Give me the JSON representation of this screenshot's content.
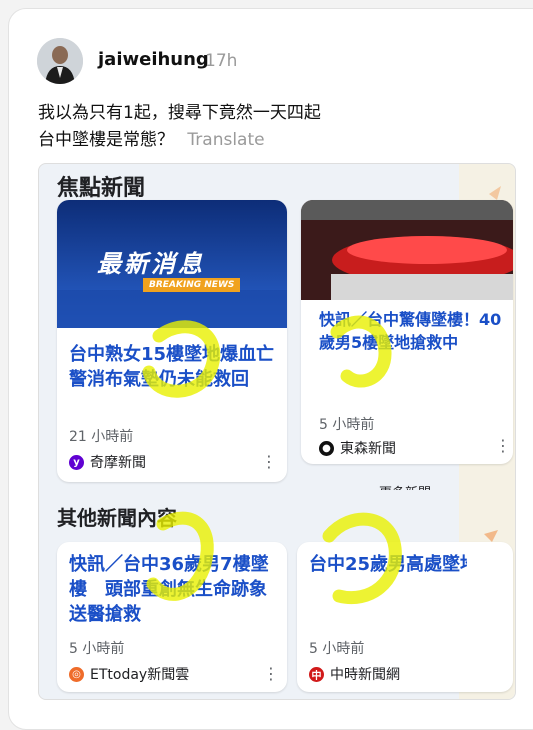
{
  "post": {
    "username": "jaiweihung",
    "time": "17h",
    "line1": "我以為只有1起，搜尋下竟然一天四起",
    "line2": "台中墜樓是常態？",
    "translate": "Translate"
  },
  "screenshot": {
    "section1_title": "焦點新聞",
    "section2_title": "其他新聞內容",
    "more_news": "更多新聞",
    "cards": [
      {
        "image_title": "最新消息",
        "image_subtitle": "BREAKING NEWS",
        "headline": "台中熟女15樓墜地爆血亡 警消布氣墊仍未能救回",
        "time": "21 小時前",
        "source": "奇摩新聞",
        "source_icon": "yahoo-icon"
      },
      {
        "headline": "快訊／台中驚傳墜樓！40歲男5樓墜地搶救中",
        "time": "5 小時前",
        "source": "東森新聞",
        "source_icon": "ebc-icon"
      },
      {
        "headline": "快訊／台中36歲男7樓墜樓　頭部重創無生命跡象送醫搶救",
        "time": "5 小時前",
        "source": "ETtoday新聞雲",
        "source_icon": "ettoday-icon"
      },
      {
        "headline": "台中25歲男高處墜地 送醫不治身亡",
        "time": "5 小時前",
        "source": "中時新聞網",
        "source_icon": "chinatimes-icon"
      }
    ],
    "colors": {
      "link": "#1a4fc7",
      "highlight": "#e8f000",
      "breaking_bg": "#1f4fb3"
    }
  }
}
